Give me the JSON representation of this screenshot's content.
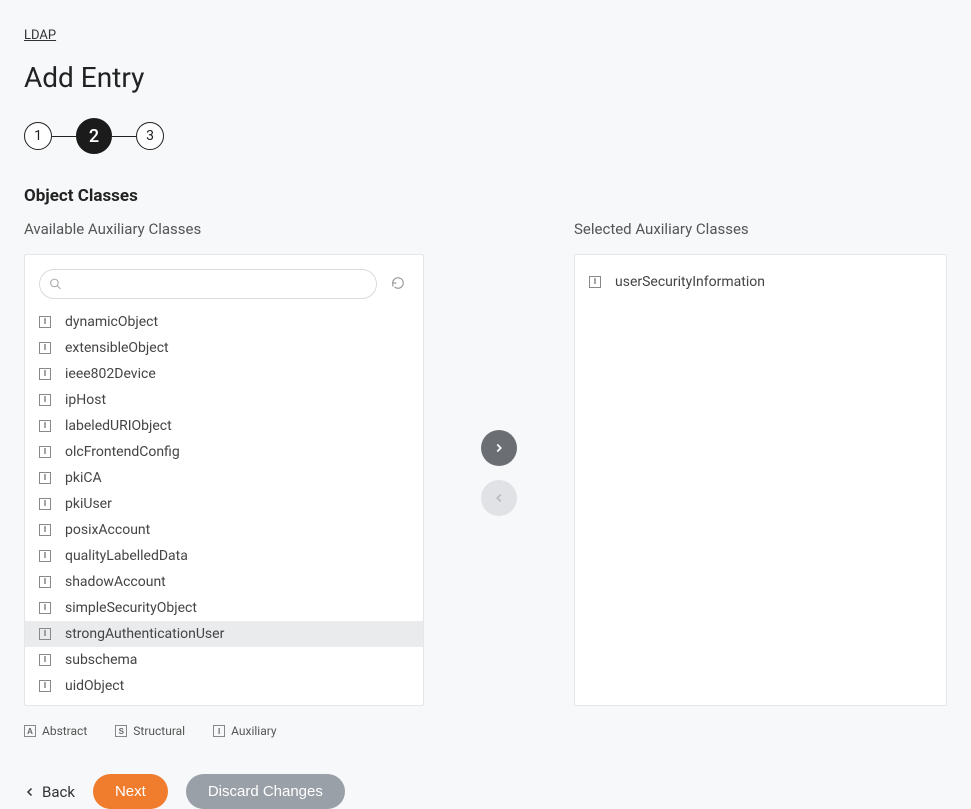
{
  "breadcrumb": "LDAP",
  "page_title": "Add Entry",
  "stepper": {
    "steps": [
      "1",
      "2",
      "3"
    ],
    "active_index": 1
  },
  "section_title": "Object Classes",
  "available": {
    "label": "Available Auxiliary Classes",
    "search_placeholder": "",
    "items": [
      {
        "name": "dynamicObject",
        "type": "I",
        "selected": false
      },
      {
        "name": "extensibleObject",
        "type": "I",
        "selected": false
      },
      {
        "name": "ieee802Device",
        "type": "I",
        "selected": false
      },
      {
        "name": "ipHost",
        "type": "I",
        "selected": false
      },
      {
        "name": "labeledURIObject",
        "type": "I",
        "selected": false
      },
      {
        "name": "olcFrontendConfig",
        "type": "I",
        "selected": false
      },
      {
        "name": "pkiCA",
        "type": "I",
        "selected": false
      },
      {
        "name": "pkiUser",
        "type": "I",
        "selected": false
      },
      {
        "name": "posixAccount",
        "type": "I",
        "selected": false
      },
      {
        "name": "qualityLabelledData",
        "type": "I",
        "selected": false
      },
      {
        "name": "shadowAccount",
        "type": "I",
        "selected": false
      },
      {
        "name": "simpleSecurityObject",
        "type": "I",
        "selected": false
      },
      {
        "name": "strongAuthenticationUser",
        "type": "I",
        "selected": true
      },
      {
        "name": "subschema",
        "type": "I",
        "selected": false
      },
      {
        "name": "uidObject",
        "type": "I",
        "selected": false
      }
    ]
  },
  "selected_panel": {
    "label": "Selected Auxiliary Classes",
    "items": [
      {
        "name": "userSecurityInformation",
        "type": "I"
      }
    ]
  },
  "legend": {
    "abstract": "Abstract",
    "structural": "Structural",
    "auxiliary": "Auxiliary"
  },
  "actions": {
    "back": "Back",
    "next": "Next",
    "discard": "Discard Changes"
  }
}
